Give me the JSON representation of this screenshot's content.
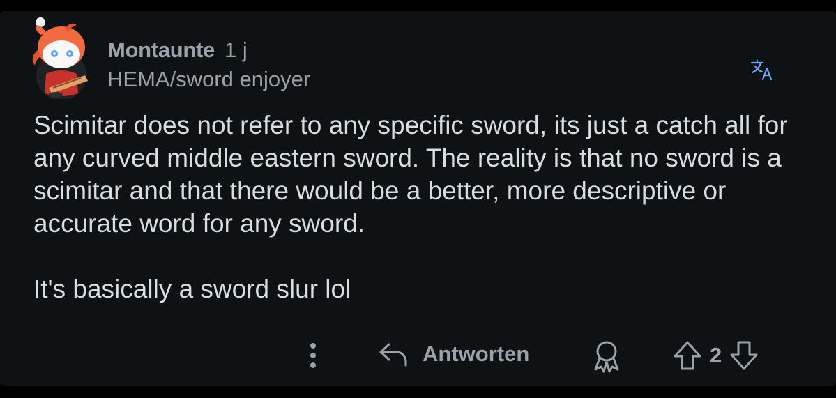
{
  "comment": {
    "username": "Montaunte",
    "timestamp": "1 j",
    "flair": "HEMA/sword enjoyer",
    "body_paragraphs": [
      "Scimitar does not refer to any specific sword, its just a catch all for any curved middle eastern sword. The reality is that no sword is a scimitar and that there would be a better, more descriptive or accurate word for any sword.",
      "It's basically a sword slur lol"
    ]
  },
  "actions": {
    "more_icon": "more-vertical-icon",
    "reply_icon": "reply-arrow-icon",
    "reply_label": "Antworten",
    "award_icon": "award-icon",
    "upvote_icon": "arrow-up-icon",
    "vote_count": "2",
    "downvote_icon": "arrow-down-icon"
  },
  "header": {
    "translate_icon": "translate-icon"
  },
  "colors": {
    "background": "#0f1215",
    "text_primary": "#d8dde2",
    "text_secondary": "#9aa3ab",
    "accent_translate": "#6aa7ff",
    "avatar_orange": "#f26a3d"
  }
}
